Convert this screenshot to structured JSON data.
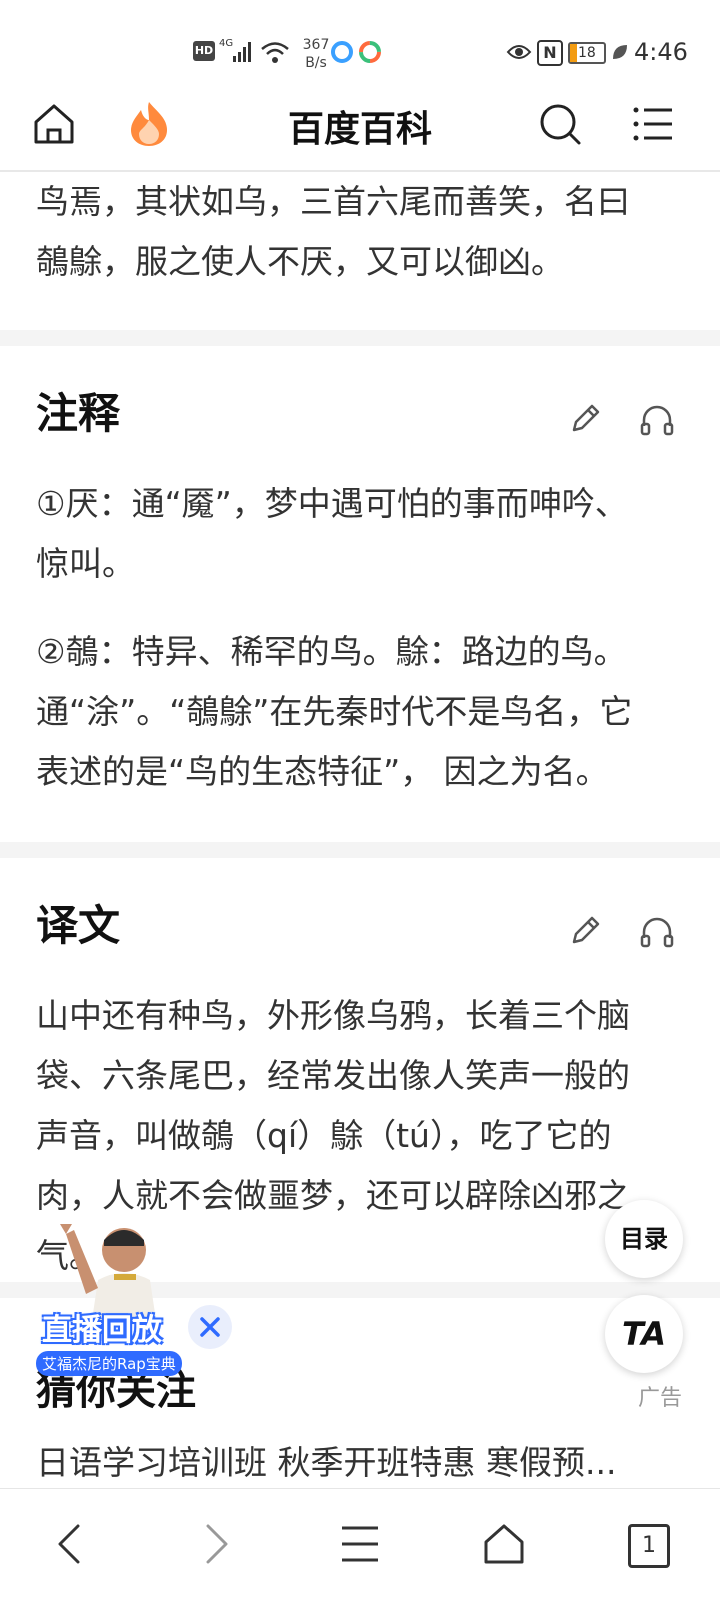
{
  "status_bar": {
    "hd": "HD",
    "net": "4G",
    "speed_top": "367",
    "speed_bottom": "B/s",
    "battery": "18",
    "time": "4:46"
  },
  "nav": {
    "title": "百度百科"
  },
  "section_top": {
    "lines": [
      "鸟焉，其状如乌，三首六尾而善笑，名曰",
      "鵸鵌，服之使人不厌，又可以御凶。"
    ]
  },
  "notes": {
    "heading": "注释",
    "p1": [
      "①厌：通“魇”，梦中遇可怕的事而呻吟、",
      "惊叫。"
    ],
    "p2": [
      "②鵸：特异、稀罕的鸟。鵌：路边的鸟。",
      "通“涂”。“鵸鵌”在先秦时代不是鸟名，它",
      "表述的是“鸟的生态特征”， 因之为名。"
    ]
  },
  "translation": {
    "heading": "译文",
    "lines": [
      "山中还有种鸟，外形像乌鸦，长着三个脑",
      "袋、六条尾巴，经常发出像人笑声一般的",
      "声音，叫做鵸（qí）鵌（tú），吃了它的",
      "肉，人就不会做噩梦，还可以辟除凶邪之",
      "气。"
    ]
  },
  "recommend": {
    "heading": "猜你关注",
    "ad_label": "广告",
    "item": "日语学习培训班 秋季开班特惠 寒假预..."
  },
  "fabs": {
    "toc": "目录",
    "ta": "TA"
  },
  "live": {
    "title": "直播回放",
    "subtitle": "艾福杰尼的Rap宝典"
  },
  "bottom_bar": {
    "tab_count": "1"
  },
  "colors": {
    "accent_orange": "#ff8a3d",
    "live_blue": "#2f6bff"
  }
}
